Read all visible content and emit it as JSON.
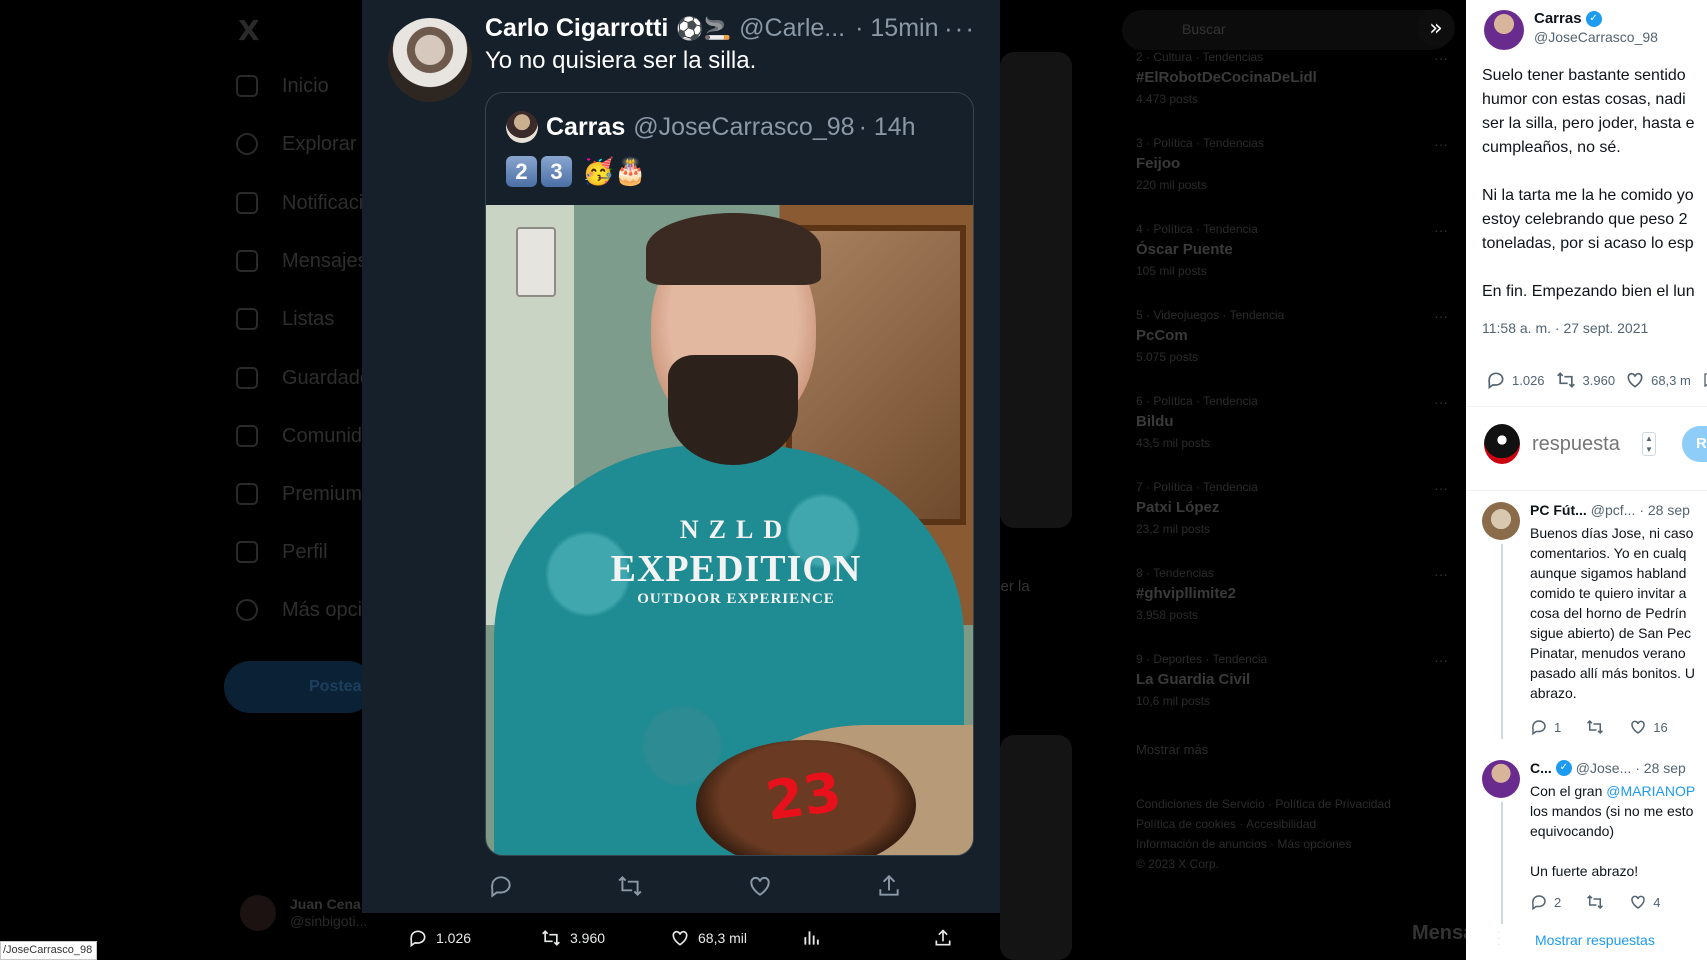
{
  "background": {
    "logo": "X",
    "nav": [
      {
        "label": "Inicio",
        "icon": "home-icon"
      },
      {
        "label": "Explorar",
        "icon": "search-icon"
      },
      {
        "label": "Notificaciones",
        "icon": "bell-icon"
      },
      {
        "label": "Mensajes",
        "icon": "mail-icon"
      },
      {
        "label": "Listas",
        "icon": "list-icon"
      },
      {
        "label": "Guardados",
        "icon": "bookmark-icon"
      },
      {
        "label": "Comunidades",
        "icon": "people-icon"
      },
      {
        "label": "Premium",
        "icon": "x-icon"
      },
      {
        "label": "Perfil",
        "icon": "user-icon"
      },
      {
        "label": "Más opciones",
        "icon": "more-circle-icon"
      }
    ],
    "post_button": "Postear",
    "user": {
      "name": "Juan Cena",
      "handle": "@sinbigoti..."
    },
    "search_placeholder": "Buscar",
    "partial_text": "ser la",
    "trends": [
      {
        "context": "2 · Cultura · Tendencias",
        "title": "#ElRobotDeCocinaDeLidl",
        "count": "4.473 posts"
      },
      {
        "context": "3 · Política · Tendencias",
        "title": "Feijoo",
        "count": "220 mil posts"
      },
      {
        "context": "4 · Política · Tendencia",
        "title": "Óscar Puente",
        "count": "105 mil posts"
      },
      {
        "context": "5 · Videojuegos · Tendencia",
        "title": "PcCom",
        "count": "5.075 posts"
      },
      {
        "context": "6 · Política · Tendencia",
        "title": "Bildu",
        "count": "43,5 mil posts"
      },
      {
        "context": "7 · Política · Tendencia",
        "title": "Patxi López",
        "count": "23,2 mil posts"
      },
      {
        "context": "8 · Tendencias",
        "title": "#ghvipllimite2",
        "count": "3.958 posts"
      },
      {
        "context": "9 · Deportes · Tendencia",
        "title": "La Guardia Civil",
        "count": "10,6 mil posts"
      }
    ],
    "show_more": "Mostrar más",
    "footer": [
      "Condiciones de Servicio",
      "Política de Privacidad",
      "Política de cookies",
      "Accesibilidad",
      "Información de anuncios",
      "Más opciones",
      "© 2023 X Corp."
    ],
    "messages_label": "Mensajes"
  },
  "modal": {
    "author": {
      "name": "Carlo Cigarrotti",
      "emoji": "⚽🚬",
      "handle": "@Carle...",
      "time": "· 15min"
    },
    "more": "···",
    "text": "Yo no quisiera ser la silla.",
    "quote": {
      "name": "Carras",
      "handle": "@JoseCarrasco_98",
      "time": "· 14h",
      "keycaps": [
        "2",
        "3"
      ],
      "emoji": "🥳🎂",
      "photo_shirt": {
        "line1": "NZLD",
        "line2": "EXPEDITION",
        "line3": "OUTDOOR EXPERIENCE"
      },
      "cake_number": "23"
    }
  },
  "bottom_bar": {
    "replies": "1.026",
    "retweets": "3.960",
    "likes": "68,3 mil"
  },
  "status_url": "/JoseCarrasco_98",
  "panel": {
    "author": {
      "name": "Carras",
      "handle": "@JoseCarrasco_98"
    },
    "body": [
      [
        "Suelo tener bastante sentido",
        "humor con estas cosas, nadi",
        "ser la silla, pero joder, hasta e",
        "cumpleaños, no sé."
      ],
      [
        "Ni la tarta me la he comido yo",
        "estoy celebrando que peso 2",
        "toneladas, por si acaso lo esp"
      ],
      [
        "En fin. Empezando bien el lun"
      ]
    ],
    "date": "11:58 a. m. · 27 sept. 2021",
    "stats": {
      "replies": "1.026",
      "retweets": "3.960",
      "likes": "68,3 m"
    },
    "reply_placeholder": "respuesta",
    "reply_button": "Res",
    "comments": [
      {
        "name": "PC Fút...",
        "handle": "@pcf...",
        "time": "· 28 sep",
        "lines": [
          "Buenos días Jose, ni caso",
          "comentarios. Yo en cualq",
          "aunque sigamos habland",
          "comido te quiero invitar a",
          "cosa del horno de Pedrín",
          "sigue abierto) de San Pec",
          "Pinatar, menudos verano",
          "pasado allí más bonitos. U",
          "abrazo."
        ],
        "replies": "1",
        "likes": "16"
      },
      {
        "name": "C...",
        "handle": "@Jose...",
        "time": "· 28 sep",
        "lines_pre": "Con el gran ",
        "mention": "@MARIANOP",
        "lines": [
          "los mandos (si no me esto",
          "equivocando)",
          "",
          "Un fuerte abrazo!"
        ],
        "replies": "2",
        "likes": "4"
      }
    ],
    "show_replies": "Mostrar respuestas"
  }
}
